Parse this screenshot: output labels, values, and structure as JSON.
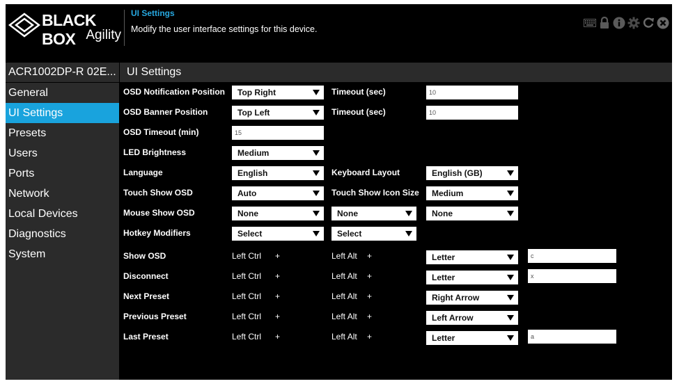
{
  "brand": {
    "name": "BLACK BOX",
    "product": "Agility"
  },
  "header": {
    "title": "UI Settings",
    "description": "Modify the user interface settings for this device."
  },
  "toolbar_icons": [
    "keyboard-icon",
    "lock-icon",
    "info-icon",
    "gear-icon",
    "refresh-icon",
    "close-icon"
  ],
  "device": {
    "name": "ACR1002DP-R 02E..."
  },
  "nav": {
    "items": [
      "General",
      "UI Settings",
      "Presets",
      "Users",
      "Ports",
      "Network",
      "Local Devices",
      "Diagnostics",
      "System"
    ],
    "active": "UI Settings"
  },
  "section": {
    "title": "UI Settings"
  },
  "form": {
    "osd_notification_position": {
      "label": "OSD Notification Position",
      "value": "Top Right",
      "timeout_label": "Timeout (sec)",
      "timeout_value": "10"
    },
    "osd_banner_position": {
      "label": "OSD Banner Position",
      "value": "Top Left",
      "timeout_label": "Timeout (sec)",
      "timeout_value": "10"
    },
    "osd_timeout": {
      "label": "OSD Timeout (min)",
      "value": "15"
    },
    "led_brightness": {
      "label": "LED Brightness",
      "value": "Medium"
    },
    "language": {
      "label": "Language",
      "value": "English",
      "keyboard_label": "Keyboard Layout",
      "keyboard_value": "English (GB)"
    },
    "touch_show_osd": {
      "label": "Touch Show OSD",
      "value": "Auto",
      "icon_size_label": "Touch Show Icon Size",
      "icon_size_value": "Medium"
    },
    "mouse_show_osd": {
      "label": "Mouse Show OSD",
      "value1": "None",
      "value2": "None",
      "value3": "None"
    },
    "hotkey_modifiers": {
      "label": "Hotkey Modifiers",
      "value1": "Select",
      "value2": "Select"
    },
    "hotkeys": [
      {
        "label": "Show OSD",
        "mod1": "Left Ctrl",
        "mod2": "Left Alt",
        "key": "Letter",
        "letter": "c"
      },
      {
        "label": "Disconnect",
        "mod1": "Left Ctrl",
        "mod2": "Left Alt",
        "key": "Letter",
        "letter": "x"
      },
      {
        "label": "Next Preset",
        "mod1": "Left Ctrl",
        "mod2": "Left Alt",
        "key": "Right Arrow",
        "letter": ""
      },
      {
        "label": "Previous Preset",
        "mod1": "Left Ctrl",
        "mod2": "Left Alt",
        "key": "Left Arrow",
        "letter": ""
      },
      {
        "label": "Last Preset",
        "mod1": "Left Ctrl",
        "mod2": "Left Alt",
        "key": "Letter",
        "letter": "a"
      }
    ],
    "plus": "+"
  },
  "colors": {
    "accent": "#19a3dd",
    "header_title": "#27a8e0",
    "panel": "#2b2b2b",
    "background": "#000000"
  }
}
